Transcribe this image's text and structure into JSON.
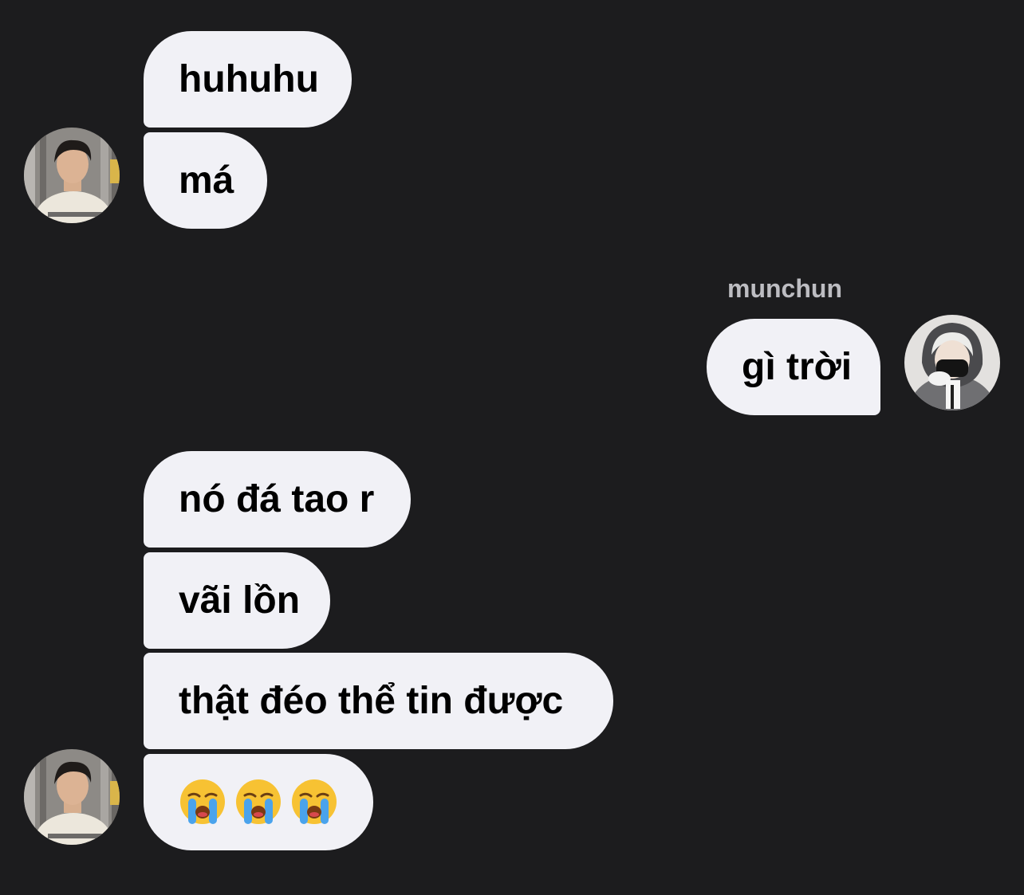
{
  "messages": {
    "group1": [
      "huhuhu",
      "má"
    ],
    "group2": {
      "sender": "munchun",
      "text": "gì trời"
    },
    "group3": [
      "nó đá tao r",
      "vãi lồn",
      "thật đéo thể tin được"
    ],
    "group3_emoji": [
      "loudly-crying-face",
      "loudly-crying-face",
      "loudly-crying-face"
    ]
  },
  "colors": {
    "background": "#1c1c1e",
    "bubble": "#f1f1f6",
    "text": "#000000",
    "sender_name": "#bdbdc2"
  }
}
